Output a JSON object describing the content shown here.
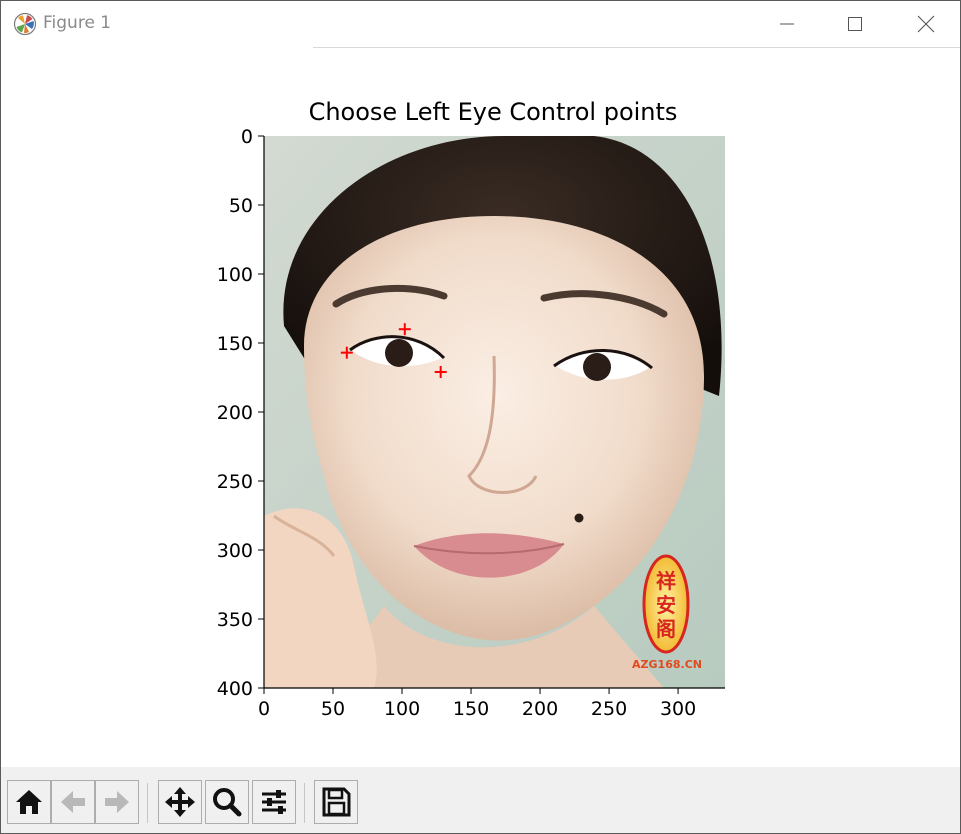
{
  "window": {
    "title": "Figure 1",
    "buttons": {
      "minimize": "minimize",
      "maximize": "maximize",
      "close": "close"
    }
  },
  "plot": {
    "title": "Choose Left Eye Control points",
    "x_ticks": [
      "0",
      "50",
      "100",
      "150",
      "200",
      "250",
      "300"
    ],
    "y_ticks": [
      "0",
      "50",
      "100",
      "150",
      "200",
      "250",
      "300",
      "350",
      "400"
    ],
    "x_range": [
      0,
      334
    ],
    "y_range": [
      0,
      400
    ],
    "y_inverted": true,
    "marker_color": "#ff0000",
    "control_points": [
      {
        "x": 60,
        "y": 157
      },
      {
        "x": 102,
        "y": 140
      },
      {
        "x": 128,
        "y": 171
      }
    ],
    "image_watermark": {
      "seal_text": "祥安阁",
      "caption": "AZG168.CN"
    }
  },
  "toolbar": {
    "tools": [
      "home-icon",
      "back-arrow-icon",
      "forward-arrow-icon",
      "pan-icon",
      "zoom-icon",
      "subplots-config-icon",
      "save-icon"
    ]
  }
}
